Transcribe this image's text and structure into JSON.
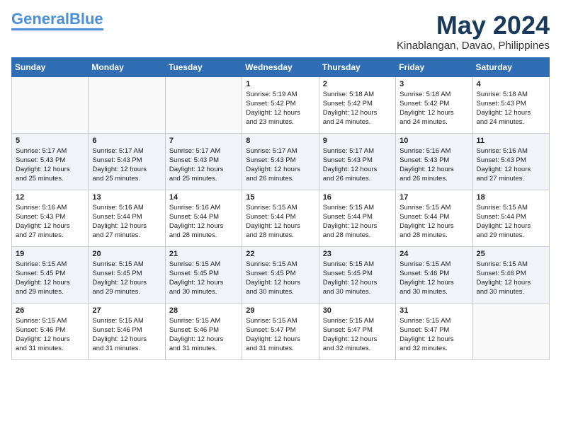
{
  "logo": {
    "general": "General",
    "blue": "Blue"
  },
  "title": "May 2024",
  "location": "Kinablangan, Davao, Philippines",
  "days_header": [
    "Sunday",
    "Monday",
    "Tuesday",
    "Wednesday",
    "Thursday",
    "Friday",
    "Saturday"
  ],
  "weeks": [
    [
      {
        "day": "",
        "text": ""
      },
      {
        "day": "",
        "text": ""
      },
      {
        "day": "",
        "text": ""
      },
      {
        "day": "1",
        "text": "Sunrise: 5:19 AM\nSunset: 5:42 PM\nDaylight: 12 hours\nand 23 minutes."
      },
      {
        "day": "2",
        "text": "Sunrise: 5:18 AM\nSunset: 5:42 PM\nDaylight: 12 hours\nand 24 minutes."
      },
      {
        "day": "3",
        "text": "Sunrise: 5:18 AM\nSunset: 5:42 PM\nDaylight: 12 hours\nand 24 minutes."
      },
      {
        "day": "4",
        "text": "Sunrise: 5:18 AM\nSunset: 5:43 PM\nDaylight: 12 hours\nand 24 minutes."
      }
    ],
    [
      {
        "day": "5",
        "text": "Sunrise: 5:17 AM\nSunset: 5:43 PM\nDaylight: 12 hours\nand 25 minutes."
      },
      {
        "day": "6",
        "text": "Sunrise: 5:17 AM\nSunset: 5:43 PM\nDaylight: 12 hours\nand 25 minutes."
      },
      {
        "day": "7",
        "text": "Sunrise: 5:17 AM\nSunset: 5:43 PM\nDaylight: 12 hours\nand 25 minutes."
      },
      {
        "day": "8",
        "text": "Sunrise: 5:17 AM\nSunset: 5:43 PM\nDaylight: 12 hours\nand 26 minutes."
      },
      {
        "day": "9",
        "text": "Sunrise: 5:17 AM\nSunset: 5:43 PM\nDaylight: 12 hours\nand 26 minutes."
      },
      {
        "day": "10",
        "text": "Sunrise: 5:16 AM\nSunset: 5:43 PM\nDaylight: 12 hours\nand 26 minutes."
      },
      {
        "day": "11",
        "text": "Sunrise: 5:16 AM\nSunset: 5:43 PM\nDaylight: 12 hours\nand 27 minutes."
      }
    ],
    [
      {
        "day": "12",
        "text": "Sunrise: 5:16 AM\nSunset: 5:43 PM\nDaylight: 12 hours\nand 27 minutes."
      },
      {
        "day": "13",
        "text": "Sunrise: 5:16 AM\nSunset: 5:44 PM\nDaylight: 12 hours\nand 27 minutes."
      },
      {
        "day": "14",
        "text": "Sunrise: 5:16 AM\nSunset: 5:44 PM\nDaylight: 12 hours\nand 28 minutes."
      },
      {
        "day": "15",
        "text": "Sunrise: 5:15 AM\nSunset: 5:44 PM\nDaylight: 12 hours\nand 28 minutes."
      },
      {
        "day": "16",
        "text": "Sunrise: 5:15 AM\nSunset: 5:44 PM\nDaylight: 12 hours\nand 28 minutes."
      },
      {
        "day": "17",
        "text": "Sunrise: 5:15 AM\nSunset: 5:44 PM\nDaylight: 12 hours\nand 28 minutes."
      },
      {
        "day": "18",
        "text": "Sunrise: 5:15 AM\nSunset: 5:44 PM\nDaylight: 12 hours\nand 29 minutes."
      }
    ],
    [
      {
        "day": "19",
        "text": "Sunrise: 5:15 AM\nSunset: 5:45 PM\nDaylight: 12 hours\nand 29 minutes."
      },
      {
        "day": "20",
        "text": "Sunrise: 5:15 AM\nSunset: 5:45 PM\nDaylight: 12 hours\nand 29 minutes."
      },
      {
        "day": "21",
        "text": "Sunrise: 5:15 AM\nSunset: 5:45 PM\nDaylight: 12 hours\nand 30 minutes."
      },
      {
        "day": "22",
        "text": "Sunrise: 5:15 AM\nSunset: 5:45 PM\nDaylight: 12 hours\nand 30 minutes."
      },
      {
        "day": "23",
        "text": "Sunrise: 5:15 AM\nSunset: 5:45 PM\nDaylight: 12 hours\nand 30 minutes."
      },
      {
        "day": "24",
        "text": "Sunrise: 5:15 AM\nSunset: 5:46 PM\nDaylight: 12 hours\nand 30 minutes."
      },
      {
        "day": "25",
        "text": "Sunrise: 5:15 AM\nSunset: 5:46 PM\nDaylight: 12 hours\nand 30 minutes."
      }
    ],
    [
      {
        "day": "26",
        "text": "Sunrise: 5:15 AM\nSunset: 5:46 PM\nDaylight: 12 hours\nand 31 minutes."
      },
      {
        "day": "27",
        "text": "Sunrise: 5:15 AM\nSunset: 5:46 PM\nDaylight: 12 hours\nand 31 minutes."
      },
      {
        "day": "28",
        "text": "Sunrise: 5:15 AM\nSunset: 5:46 PM\nDaylight: 12 hours\nand 31 minutes."
      },
      {
        "day": "29",
        "text": "Sunrise: 5:15 AM\nSunset: 5:47 PM\nDaylight: 12 hours\nand 31 minutes."
      },
      {
        "day": "30",
        "text": "Sunrise: 5:15 AM\nSunset: 5:47 PM\nDaylight: 12 hours\nand 32 minutes."
      },
      {
        "day": "31",
        "text": "Sunrise: 5:15 AM\nSunset: 5:47 PM\nDaylight: 12 hours\nand 32 minutes."
      },
      {
        "day": "",
        "text": ""
      }
    ]
  ]
}
